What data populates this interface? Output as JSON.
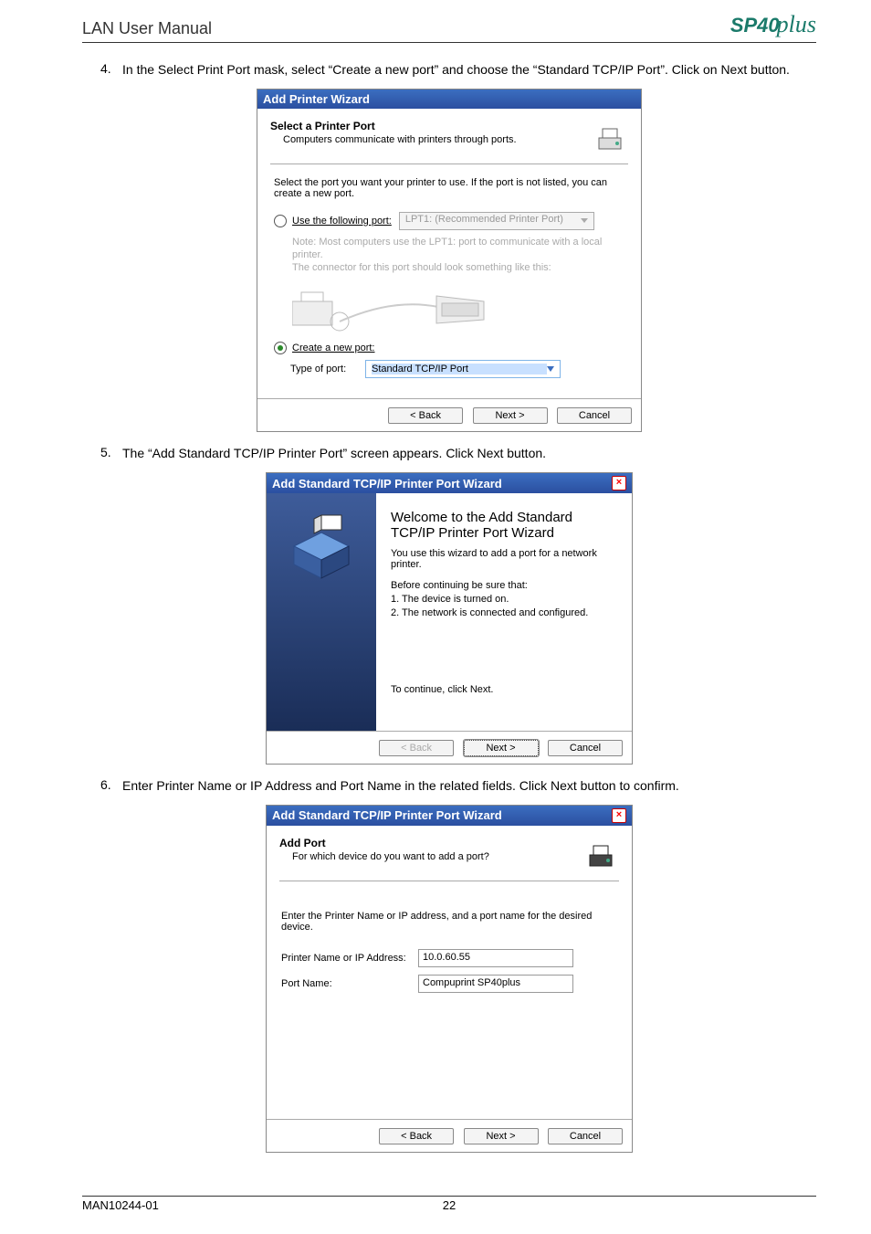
{
  "page": {
    "header_title": "LAN User Manual",
    "logo_main": "SP40",
    "logo_cursive": "plus",
    "footer_left": "MAN10244-01",
    "footer_page": "22"
  },
  "steps": {
    "s4_num": "4.",
    "s4_text": "In the Select Print Port mask, select “Create a new port”  and choose the “Standard TCP/IP Port”. Click on Next button.",
    "s5_num": "5.",
    "s5_text": "The “Add Standard TCP/IP Printer Port” screen appears. Click Next button.",
    "s6_num": "6.",
    "s6_text": "Enter Printer Name or IP Address and Port Name in the related fields.  Click  Next button to confirm."
  },
  "dialog1": {
    "title": "Add Printer Wizard",
    "sub_title": "Select a Printer Port",
    "sub_desc": "Computers communicate with printers through ports.",
    "intro": "Select the port you want your printer to use.  If the port is not listed, you can create a new port.",
    "radio_existing_label": "Use the following port:",
    "existing_port_value": "LPT1: (Recommended Printer Port)",
    "note_line1": "Note: Most computers use the LPT1: port to communicate with a local printer.",
    "note_line2": "The connector for this port should look something like this:",
    "radio_create_label": "Create a new port:",
    "type_label": "Type of port:",
    "type_value": "Standard TCP/IP Port",
    "btn_back": "< Back",
    "btn_next": "Next >",
    "btn_cancel": "Cancel"
  },
  "dialog2": {
    "title": "Add Standard TCP/IP Printer Port Wizard",
    "welcome_l1": "Welcome to the Add Standard",
    "welcome_l2": "TCP/IP Printer Port Wizard",
    "desc": "You use this wizard to add a port for a network printer.",
    "before": "Before continuing be sure that:",
    "b1": "1.  The device is turned on.",
    "b2": "2.  The network is connected and configured.",
    "continue": "To continue, click Next.",
    "btn_back": "< Back",
    "btn_next": "Next >",
    "btn_cancel": "Cancel"
  },
  "dialog3": {
    "title": "Add Standard TCP/IP Printer Port Wizard",
    "sub_title": "Add Port",
    "sub_desc": "For which device do you want to add a port?",
    "intro": "Enter the Printer Name or IP address, and a port name for the desired device.",
    "lbl_printer": "Printer Name or IP Address:",
    "val_printer": "10.0.60.55",
    "lbl_port": "Port Name:",
    "val_port": "Compuprint SP40plus",
    "btn_back": "< Back",
    "btn_next": "Next >",
    "btn_cancel": "Cancel"
  }
}
